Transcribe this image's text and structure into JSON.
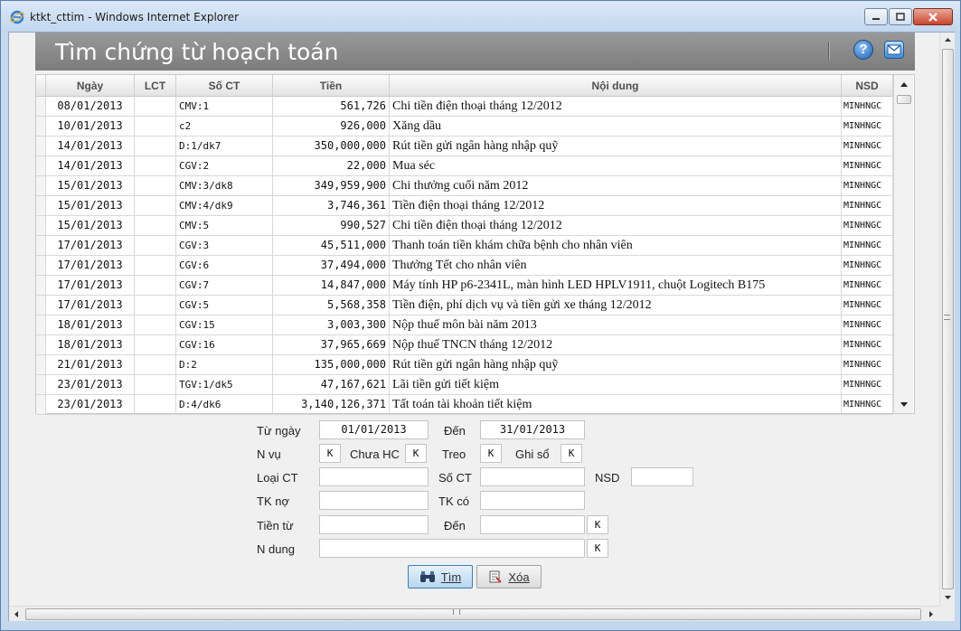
{
  "window": {
    "title": "ktkt_cttim - Windows Internet Explorer",
    "icon": "internet-explorer-icon"
  },
  "header": {
    "title": "Tìm chứng từ hoạch toán",
    "help_icon": "?",
    "mail_icon": "mail-icon"
  },
  "grid": {
    "columns": [
      "Ngày",
      "LCT",
      "Số CT",
      "Tiền",
      "Nội dung",
      "NSD"
    ],
    "rows": [
      {
        "date": "08/01/2013",
        "lct": "",
        "soct": "CMV:1",
        "tien": "561,726",
        "noidung": "Chi tiền điện thoại tháng 12/2012",
        "nsd": "MINHNGC"
      },
      {
        "date": "10/01/2013",
        "lct": "",
        "soct": "c2",
        "tien": "926,000",
        "noidung": "Xăng dầu",
        "nsd": "MINHNGC"
      },
      {
        "date": "14/01/2013",
        "lct": "",
        "soct": "D:1/dk7",
        "tien": "350,000,000",
        "noidung": "Rút tiền gửi ngân hàng nhập quỹ",
        "nsd": "MINHNGC"
      },
      {
        "date": "14/01/2013",
        "lct": "",
        "soct": "CGV:2",
        "tien": "22,000",
        "noidung": "Mua séc",
        "nsd": "MINHNGC"
      },
      {
        "date": "15/01/2013",
        "lct": "",
        "soct": "CMV:3/dk8",
        "tien": "349,959,900",
        "noidung": "Chi thưởng cuối năm 2012",
        "nsd": "MINHNGC"
      },
      {
        "date": "15/01/2013",
        "lct": "",
        "soct": "CMV:4/dk9",
        "tien": "3,746,361",
        "noidung": "Tiền điện thoại tháng 12/2012",
        "nsd": "MINHNGC"
      },
      {
        "date": "15/01/2013",
        "lct": "",
        "soct": "CMV:5",
        "tien": "990,527",
        "noidung": "Chi tiền điện thoại tháng 12/2012",
        "nsd": "MINHNGC"
      },
      {
        "date": "17/01/2013",
        "lct": "",
        "soct": "CGV:3",
        "tien": "45,511,000",
        "noidung": "Thanh toán tiền khám chữa bệnh cho nhân viên",
        "nsd": "MINHNGC"
      },
      {
        "date": "17/01/2013",
        "lct": "",
        "soct": "CGV:6",
        "tien": "37,494,000",
        "noidung": "Thưởng Tết cho nhân viên",
        "nsd": "MINHNGC"
      },
      {
        "date": "17/01/2013",
        "lct": "",
        "soct": "CGV:7",
        "tien": "14,847,000",
        "noidung": "Máy tính HP p6-2341L, màn hình LED HPLV1911, chuột Logitech B175",
        "nsd": "MINHNGC"
      },
      {
        "date": "17/01/2013",
        "lct": "",
        "soct": "CGV:5",
        "tien": "5,568,358",
        "noidung": "Tiền điện, phí dịch vụ và tiền gửi xe tháng 12/2012",
        "nsd": "MINHNGC"
      },
      {
        "date": "18/01/2013",
        "lct": "",
        "soct": "CGV:15",
        "tien": "3,003,300",
        "noidung": "Nộp thuế môn bài năm 2013",
        "nsd": "MINHNGC"
      },
      {
        "date": "18/01/2013",
        "lct": "",
        "soct": "CGV:16",
        "tien": "37,965,669",
        "noidung": "Nộp thuế TNCN tháng 12/2012",
        "nsd": "MINHNGC"
      },
      {
        "date": "21/01/2013",
        "lct": "",
        "soct": "D:2",
        "tien": "135,000,000",
        "noidung": "Rút tiền gửi ngân hàng nhập quỹ",
        "nsd": "MINHNGC"
      },
      {
        "date": "23/01/2013",
        "lct": "",
        "soct": "TGV:1/dk5",
        "tien": "47,167,621",
        "noidung": "Lãi tiền gửi tiết kiệm",
        "nsd": "MINHNGC"
      },
      {
        "date": "23/01/2013",
        "lct": "",
        "soct": "D:4/dk6",
        "tien": "3,140,126,371",
        "noidung": "Tất toán tài khoản tiết kiệm",
        "nsd": "MINHNGC"
      }
    ]
  },
  "filter": {
    "tu_ngay_label": "Từ ngày",
    "tu_ngay_value": "01/01/2013",
    "den_label": "Đến",
    "den_value": "31/01/2013",
    "nvu_label": "N vụ",
    "nvu_value": "K",
    "chua_hc_label": "Chưa HC",
    "chua_hc_value": "K",
    "treo_label": "Treo",
    "treo_value": "K",
    "ghi_so_label": "Ghi sổ",
    "ghi_so_value": "K",
    "loai_ct_label": "Loại CT",
    "loai_ct_value": "",
    "so_ct_label": "Số CT",
    "so_ct_value": "",
    "nsd_label": "NSD",
    "nsd_value": "",
    "tk_no_label": "TK nợ",
    "tk_no_value": "",
    "tk_co_label": "TK có",
    "tk_co_value": "",
    "tien_tu_label": "Tiền từ",
    "tien_tu_value": "",
    "tien_den_label": "Đến",
    "tien_den_value": "",
    "tien_den_k": "K",
    "ndung_label": "N dung",
    "ndung_value": "",
    "ndung_k": "K"
  },
  "buttons": {
    "tim_label": "Tìm",
    "xoa_label": "Xóa"
  },
  "colors": {
    "header_bg": "#8a8a8a",
    "accent": "#3c7fb1"
  }
}
